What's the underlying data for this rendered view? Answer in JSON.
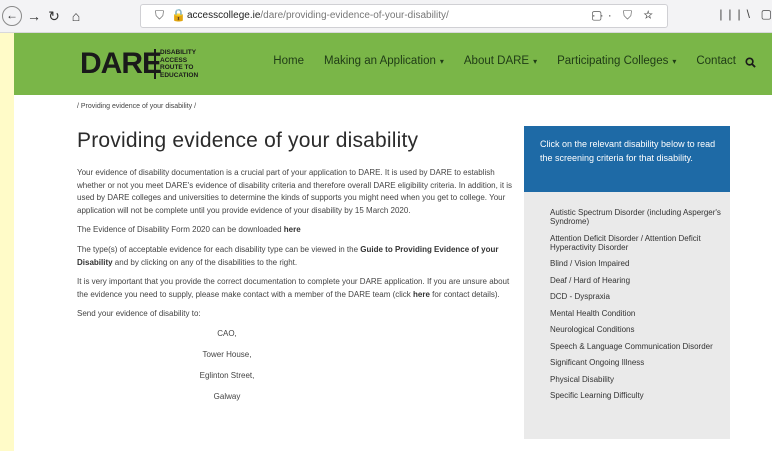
{
  "browser": {
    "url_domain": "accesscollege.ie",
    "url_path": "/dare/providing-evidence-of-your-disability/",
    "url_actions": "··· ⛉ ☆"
  },
  "site": {
    "logo_text": "DARE",
    "logo_sub": [
      "DISABILITY",
      "ACCESS",
      "ROUTE TO",
      "EDUCATION"
    ],
    "nav": [
      {
        "label": "Home",
        "caret": ""
      },
      {
        "label": "Making an Application",
        "caret": "▾"
      },
      {
        "label": "About DARE",
        "caret": "▾"
      },
      {
        "label": "Participating Colleges",
        "caret": "▾"
      },
      {
        "label": "Contact",
        "caret": ""
      }
    ]
  },
  "breadcrumb": "/ Providing evidence of your disability /",
  "page_title": "Providing evidence of your disability",
  "body": {
    "p1": "Your evidence of disability documentation is a crucial part of your application to DARE. It is used by DARE to establish whether or not you meet DARE's evidence of disability criteria and therefore overall DARE eligibility criteria. In addition, it is used by DARE colleges and universities to determine the kinds of supports you might need when you get to college. Your application will not be complete until you provide evidence of your disability by 15 March 2020.",
    "p2_pre": "The Evidence of Disability Form 2020 can be downloaded ",
    "p2_link": "here",
    "p3_pre": "The type(s) of acceptable evidence for each disability type can be viewed in the ",
    "p3_link": "Guide to Providing Evidence of your Disability",
    "p3_post": " and by clicking on any of the disabilities to the right.",
    "p4_pre": "It is very important that you provide the correct documentation to complete your DARE application. If you are unsure about the evidence you need to supply, please make contact with a member of the DARE team (click ",
    "p4_link": "here",
    "p4_post": " for contact details).",
    "p5": "Send your evidence of disability to:",
    "address": [
      "CAO,",
      "Tower House,",
      "Eglinton Street,",
      "Galway"
    ]
  },
  "sidebar": {
    "intro": "Click on the relevant disability below to read the screening criteria for that disability.",
    "items": [
      "Autistic Spectrum Disorder (including Asperger's Syndrome)",
      "Attention Deficit Disorder / Attention Deficit Hyperactivity Disorder",
      "Blind / Vision Impaired",
      "Deaf / Hard of Hearing",
      "DCD - Dyspraxia",
      "Mental Health Condition",
      "Neurological Conditions",
      "Speech & Language Communication Disorder",
      "Significant Ongoing Illness",
      "Physical Disability",
      "Specific Learning Difficulty"
    ]
  },
  "colors": {
    "header_green": "#7ab648",
    "sidebar_blue": "#1e6aa6",
    "sidebar_grey": "#eaeaea",
    "margin_yellow": "#fffbc8"
  },
  "icons": [
    "back-arrow-icon",
    "forward-arrow-icon",
    "reload-icon",
    "home-icon",
    "shield-icon",
    "lock-icon",
    "page-icon",
    "library-icon",
    "sidebar-toggle-icon",
    "search-icon"
  ]
}
